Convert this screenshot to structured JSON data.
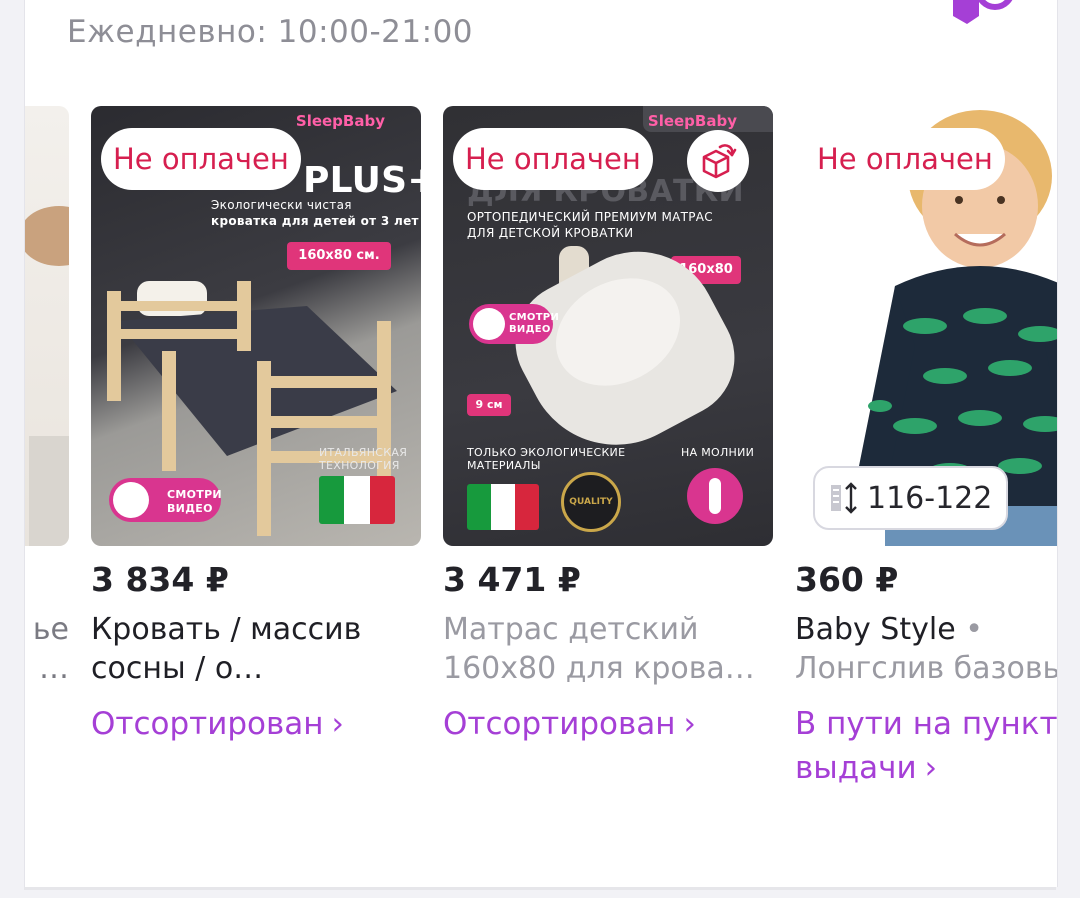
{
  "header": {
    "hours": "Ежедневно: 10:00-21:00",
    "map_icon": "map-compass-icon"
  },
  "colors": {
    "accent": "#a53fd6",
    "badge_text": "#d61f4f",
    "price": "#222228",
    "muted": "#9a9aa2"
  },
  "products": [
    {
      "title_line1": "ье",
      "title_line2": "…"
    },
    {
      "price": "3 834 ₽",
      "title": "Кровать / массив сосны / о…",
      "status": "Отсортирован",
      "badge": "Не оплачен",
      "image": {
        "logo": "SleepBaby",
        "headline": "PLUS+",
        "sub1": "Экологически чистая",
        "sub2": "кроватка для детей от 3 лет",
        "size": "160x80 см.",
        "tech1": "ИТАЛЬЯНСКАЯ",
        "tech2": "ТЕХНОЛОГИЯ",
        "video1": "СМОТРИ",
        "video2": "ВИДЕО"
      }
    },
    {
      "price": "3 471 ₽",
      "title": "Матрас детский 160x80 для крова…",
      "status": "Отсортирован",
      "badge": "Не оплачен",
      "return_icon": "return-box-icon",
      "image": {
        "logo": "SleepBaby",
        "headline": "ДЛЯ КРОВАТКИ",
        "sub1": "ОРТОПЕДИЧЕСКИЙ ПРЕМИУМ МАТРАС",
        "sub2": "ДЛЯ ДЕТСКОЙ КРОВАТКИ",
        "size": "160x80",
        "thickness": "9 см",
        "eco1": "ТОЛЬКО ЭКОЛОГИЧЕСКИЕ",
        "eco2": "МАТЕРИАЛЫ",
        "zipper": "НА МОЛНИИ",
        "quality": "QUALITY",
        "video1": "СМОТРИ",
        "video2": "ВИДЕО"
      }
    },
    {
      "price": "360 ₽",
      "brand": "Baby Style",
      "title": "Лонгслив базовый",
      "status": "В пути на пункт выдачи",
      "badge": "Не оплачен",
      "size": "116-122",
      "size_icon": "height-arrows-icon"
    }
  ]
}
